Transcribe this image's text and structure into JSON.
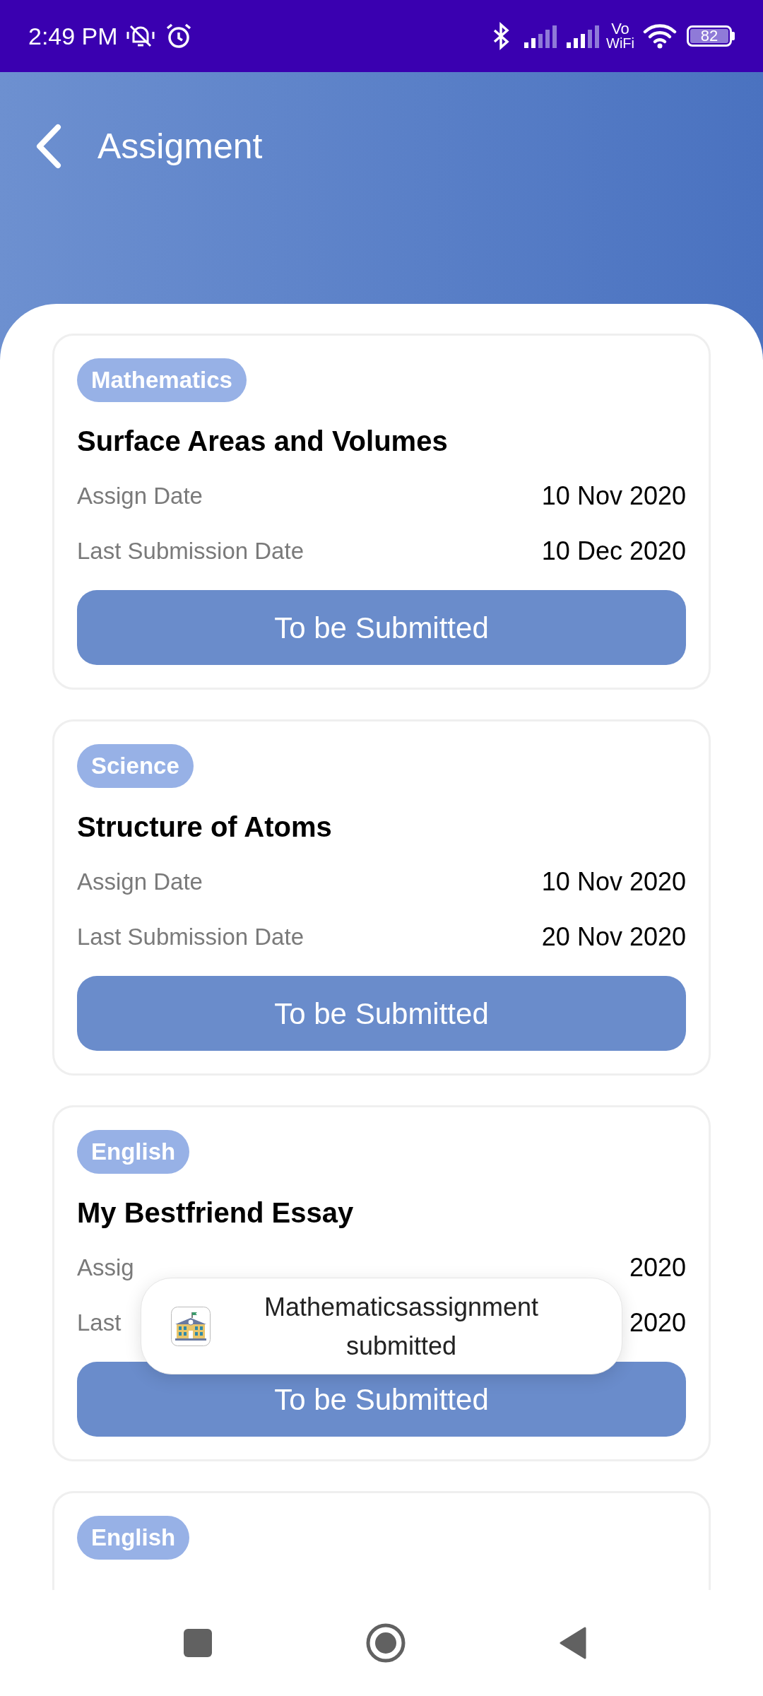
{
  "status_bar": {
    "time": "2:49 PM",
    "volte_top": "Vo",
    "volte_bottom": "WiFi",
    "battery": "82"
  },
  "header": {
    "title": "Assigment"
  },
  "assignments": [
    {
      "subject": "Mathematics",
      "title": "Surface Areas and Volumes",
      "assign_label": "Assign Date",
      "assign_date": "10 Nov 2020",
      "last_label": "Last Submission Date",
      "last_date": "10 Dec 2020",
      "button": "To be Submitted"
    },
    {
      "subject": "Science",
      "title": "Structure of Atoms",
      "assign_label": "Assign Date",
      "assign_date": "10 Nov 2020",
      "last_label": "Last Submission Date",
      "last_date": "20 Nov 2020",
      "button": "To be Submitted"
    },
    {
      "subject": "English",
      "title": "My Bestfriend Essay",
      "assign_label": "Assig",
      "assign_date": "2020",
      "last_label": "Last",
      "last_date": "2020",
      "button": "To be Submitted"
    },
    {
      "subject": "English"
    }
  ],
  "toast": {
    "message": "Mathematicsassignment submitted"
  }
}
